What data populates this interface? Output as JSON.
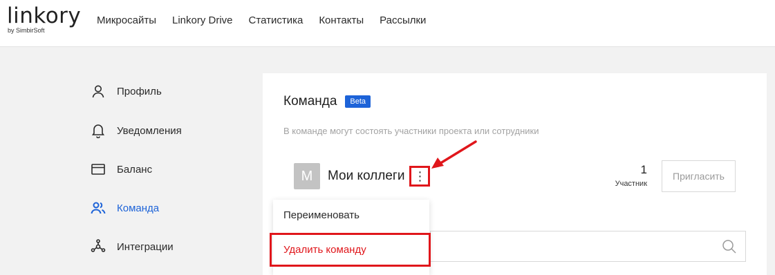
{
  "header": {
    "logo": "linkory",
    "logo_sub": "by SimbirSoft",
    "nav": [
      "Микросайты",
      "Linkory Drive",
      "Статистика",
      "Контакты",
      "Рассылки"
    ]
  },
  "sidebar": {
    "items": [
      {
        "label": "Профиль",
        "icon": "user-icon"
      },
      {
        "label": "Уведомления",
        "icon": "bell-icon"
      },
      {
        "label": "Баланс",
        "icon": "card-icon"
      },
      {
        "label": "Команда",
        "icon": "team-icon",
        "active": true
      },
      {
        "label": "Интеграции",
        "icon": "integrations-icon"
      }
    ]
  },
  "team": {
    "title": "Команда",
    "badge": "Beta",
    "description": "В команде могут состоять участники проекта или сотрудники",
    "avatar_letter": "М",
    "name": "Мои коллеги",
    "more": "⋮",
    "member_count": "1",
    "member_label": "Участник",
    "invite_label": "Пригласить"
  },
  "menu": {
    "rename": "Переименовать",
    "delete": "Удалить команду"
  },
  "colors": {
    "accent": "#1d63d8",
    "highlight": "#e0161b"
  }
}
